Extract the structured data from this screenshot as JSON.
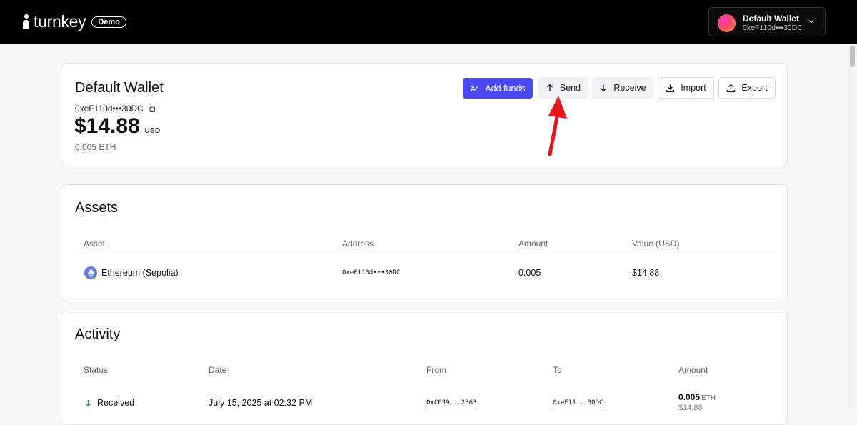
{
  "header": {
    "logo_text": "turnkey",
    "badge": "Demo",
    "wallet_switcher": {
      "name": "Default Wallet",
      "address": "0xeF110d•••30DC"
    }
  },
  "wallet": {
    "title": "Default Wallet",
    "address": "0xeF110d•••30DC",
    "balance": "$14.88",
    "balance_unit": "USD",
    "balance_eth": "0.005 ETH",
    "actions": {
      "add_funds": "Add funds",
      "send": "Send",
      "receive": "Receive",
      "import": "Import",
      "export": "Export"
    }
  },
  "assets": {
    "title": "Assets",
    "columns": [
      "Asset",
      "Address",
      "Amount",
      "Value (USD)"
    ],
    "rows": [
      {
        "asset": "Ethereum (Sepolia)",
        "address": "0xeF110d•••30DC",
        "amount": "0.005",
        "value": "$14.88"
      }
    ]
  },
  "activity": {
    "title": "Activity",
    "columns": [
      "Status",
      "Date",
      "From",
      "To",
      "Amount"
    ],
    "rows": [
      {
        "status": "Received",
        "date": "July 15, 2025 at 02:32 PM",
        "from": "0xC639...2363",
        "to": "0xeF11...30DC",
        "amount": "0.005",
        "amount_unit": "ETH",
        "amount_usd": "$14.88"
      }
    ]
  },
  "colors": {
    "accent": "#4a4af4",
    "topbar": "#000000",
    "annotation_arrow": "#e8141c",
    "received_green": "#2e9e4f"
  }
}
